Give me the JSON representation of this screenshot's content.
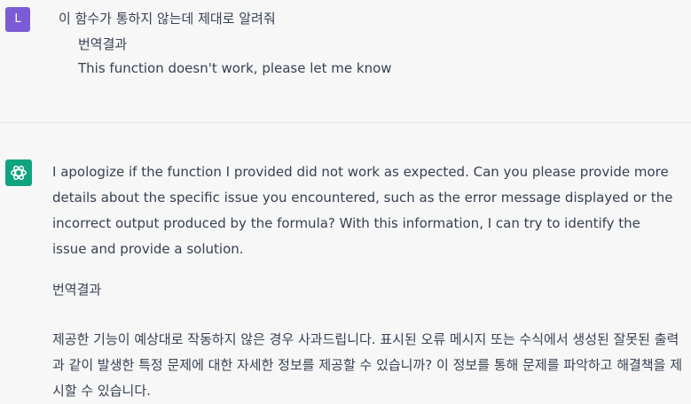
{
  "user": {
    "avatar_letter": "L",
    "avatar_color": "#7c5bd6",
    "message": "이 함수가 통하지 않는데 제대로 알려줘",
    "translation_label": "번역결과",
    "translation": "This function doesn't work, please let me know"
  },
  "assistant": {
    "logo_icon": "openai-logo-icon",
    "logo_color": "#10a37f",
    "message_en": "I apologize if the function I provided did not work as expected. Can you please provide more details about the specific issue you encountered, such as the error message displayed or the incorrect output produced by the formula? With this information, I can try to identify the issue and provide a solution.",
    "translation_label": "번역결과",
    "message_ko": "제공한 기능이 예상대로 작동하지 않은 경우 사과드립니다. 표시된 오류 메시지 또는 수식에서 생성된 잘못된 출력과 같이 발생한 특정 문제에 대한 자세한 정보를 제공할 수 있습니까? 이 정보를 통해 문제를 파악하고 해결책을 제시할 수 있습니다."
  }
}
